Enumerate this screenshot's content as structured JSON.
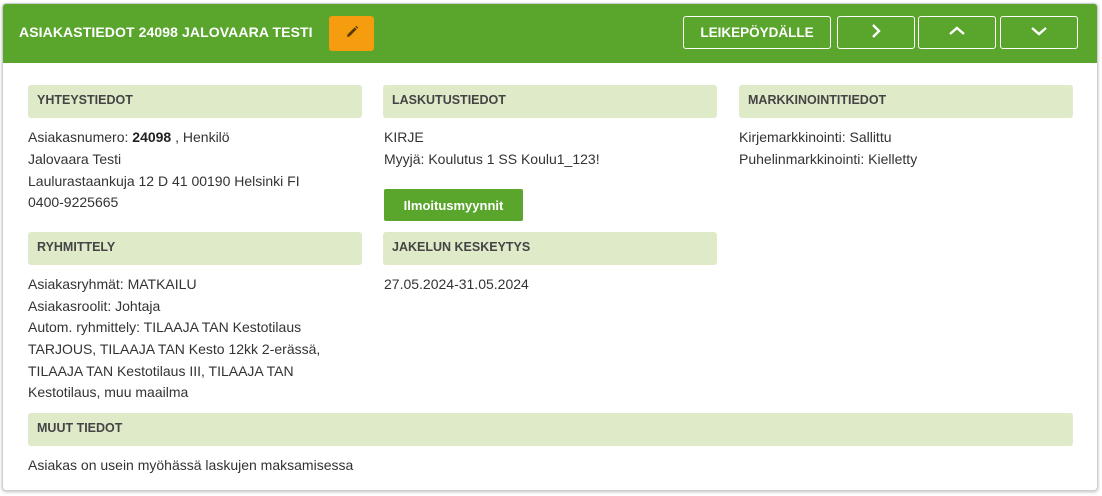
{
  "header": {
    "title": "ASIAKASTIEDOT 24098 JALOVAARA TESTI",
    "clipboard_label": "LEIKEPÖYDÄLLE",
    "edit_icon": "pencil-icon",
    "next_icon": "chevron-right-icon",
    "up_icon": "chevron-up-icon",
    "down_icon": "chevron-down-icon",
    "color": "#5aa52c",
    "edit_color": "#f59c0f"
  },
  "contact": {
    "heading": "YHTEYSTIEDOT",
    "customer_number_label": "Asiakasnumero:",
    "customer_number": "24098",
    "customer_type": ", Henkilö",
    "name": "Jalovaara Testi",
    "address": "Laulurastaankuja 12 D 41 00190 Helsinki FI",
    "phone": "0400-9225665"
  },
  "billing": {
    "heading": "LASKUTUSTIEDOT",
    "method": "KIRJE",
    "seller": "Myyjä: Koulutus 1 SS Koulu1_123!",
    "ad_sales_button": "Ilmoitusmyynnit"
  },
  "marketing": {
    "heading": "MARKKINOINTITIEDOT",
    "letter": "Kirjemarkkinointi: Sallittu",
    "phone": "Puhelinmarkkinointi: Kielletty"
  },
  "grouping": {
    "heading": "RYHMITTELY",
    "groups": "Asiakasryhmät: MATKAILU",
    "roles": "Asiakasroolit: Johtaja",
    "auto": "Autom. ryhmittely: TILAAJA TAN Kestotilaus TARJOUS, TILAAJA TAN Kesto 12kk 2-erässä, TILAAJA TAN Kestotilaus III, TILAAJA TAN Kestotilaus, muu maailma"
  },
  "delivery_pause": {
    "heading": "JAKELUN KESKEYTYS",
    "period": "27.05.2024-31.05.2024"
  },
  "other": {
    "heading": "MUUT TIEDOT",
    "note": "Asiakas on usein myöhässä laskujen maksamisessa"
  },
  "colors": {
    "section_bg": "#dfeac9"
  }
}
